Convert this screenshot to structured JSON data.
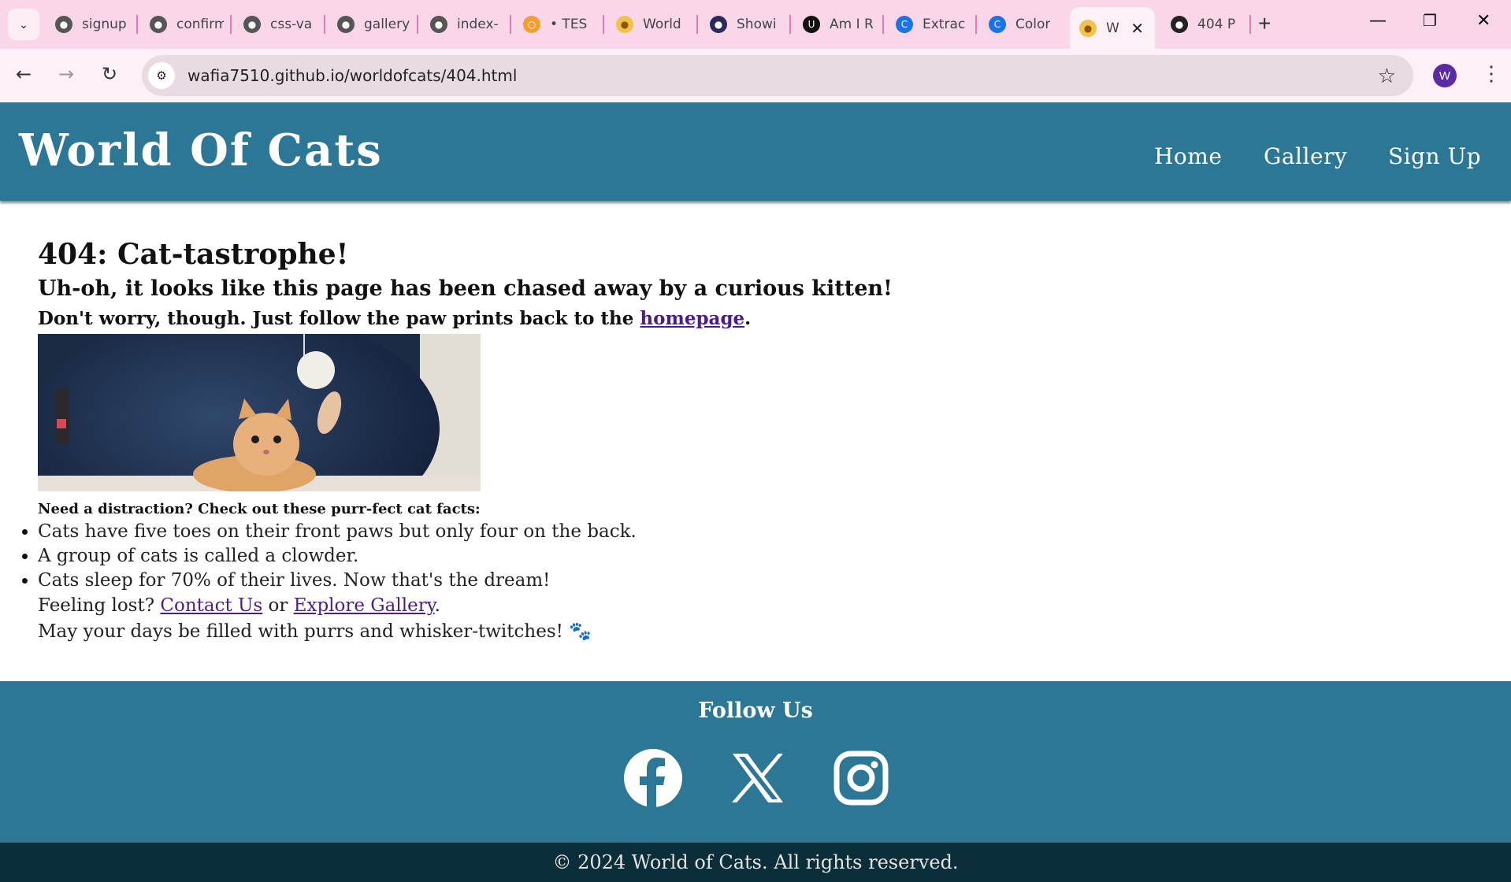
{
  "browser": {
    "tabs": [
      {
        "title": "signup",
        "favicon": "globe-icon"
      },
      {
        "title": "confirm",
        "favicon": "globe-icon"
      },
      {
        "title": "css-va",
        "favicon": "globe-icon"
      },
      {
        "title": "gallery",
        "favicon": "globe-icon"
      },
      {
        "title": "index-",
        "favicon": "globe-icon"
      },
      {
        "title": "• TES",
        "favicon": "codepen-icon"
      },
      {
        "title": "World",
        "favicon": "cat-icon"
      },
      {
        "title": "Showi",
        "favicon": "site-icon"
      },
      {
        "title": "Am I R",
        "favicon": "amiresponsive-icon"
      },
      {
        "title": "Extrac",
        "favicon": "c-logo-icon"
      },
      {
        "title": "Color",
        "favicon": "c-logo-icon"
      },
      {
        "title": "W",
        "favicon": "cat-icon",
        "active": true
      },
      {
        "title": "404 P",
        "favicon": "github-icon"
      }
    ],
    "url": "wafia7510.github.io/worldofcats/404.html",
    "profile_initial": "W"
  },
  "site": {
    "title": "World Of Cats",
    "nav": [
      "Home",
      "Gallery",
      "Sign Up"
    ]
  },
  "main": {
    "heading": "404: Cat-tastrophe!",
    "subheading": "Uh-oh, it looks like this page has been chased away by a curious kitten!",
    "tagline_before": "Don't worry, though. Just follow the paw prints back to the ",
    "tagline_link": "homepage",
    "tagline_after": ".",
    "image_alt": "kitten playing with a pom-pom in a blue cat bed",
    "facts_title": "Need a distraction? Check out these purr-fect cat facts:",
    "facts": [
      "Cats have five toes on their front paws but only four on the back.",
      "A group of cats is called a clowder.",
      "Cats sleep for 70% of their lives. Now that's the dream!"
    ],
    "lost_before": "Feeling lost? ",
    "lost_link1": "Contact Us",
    "lost_mid": " or ",
    "lost_link2": "Explore Gallery",
    "lost_after": ".",
    "closing": "May your days be filled with purrs and whisker-twitches! 🐾"
  },
  "footer": {
    "follow_title": "Follow Us",
    "social": [
      "facebook-icon",
      "x-twitter-icon",
      "instagram-icon"
    ],
    "copyright": "© 2024 World of Cats. All rights reserved."
  },
  "colors": {
    "header_bg": "#2c7696",
    "copyright_bg": "#0b2f3a",
    "link": "#4b1d8c",
    "tabstrip": "#f9d6e8"
  }
}
